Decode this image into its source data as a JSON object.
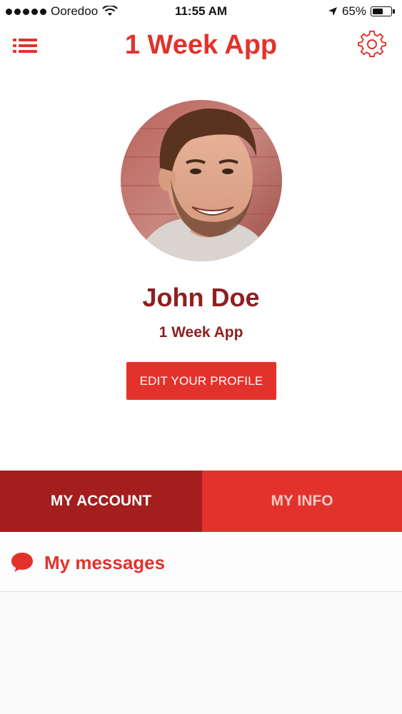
{
  "status_bar": {
    "carrier": "Ooredoo",
    "time": "11:55 AM",
    "battery": "65%",
    "battery_level": 0.65
  },
  "nav": {
    "title": "1 Week App",
    "left_icon": "menu-list-icon",
    "right_icon": "gear-icon"
  },
  "profile": {
    "name": "John Doe",
    "subtitle": "1 Week App",
    "edit_button": "EDIT YOUR PROFILE"
  },
  "tabs": [
    {
      "label": "MY ACCOUNT",
      "active": true
    },
    {
      "label": "MY INFO",
      "active": false
    }
  ],
  "messages_row": {
    "label": "My messages",
    "icon": "chat-bubble-icon"
  },
  "colors": {
    "accent": "#e3322b",
    "accent_dark": "#a41e1d",
    "text_dark_red": "#8f1f1f"
  }
}
